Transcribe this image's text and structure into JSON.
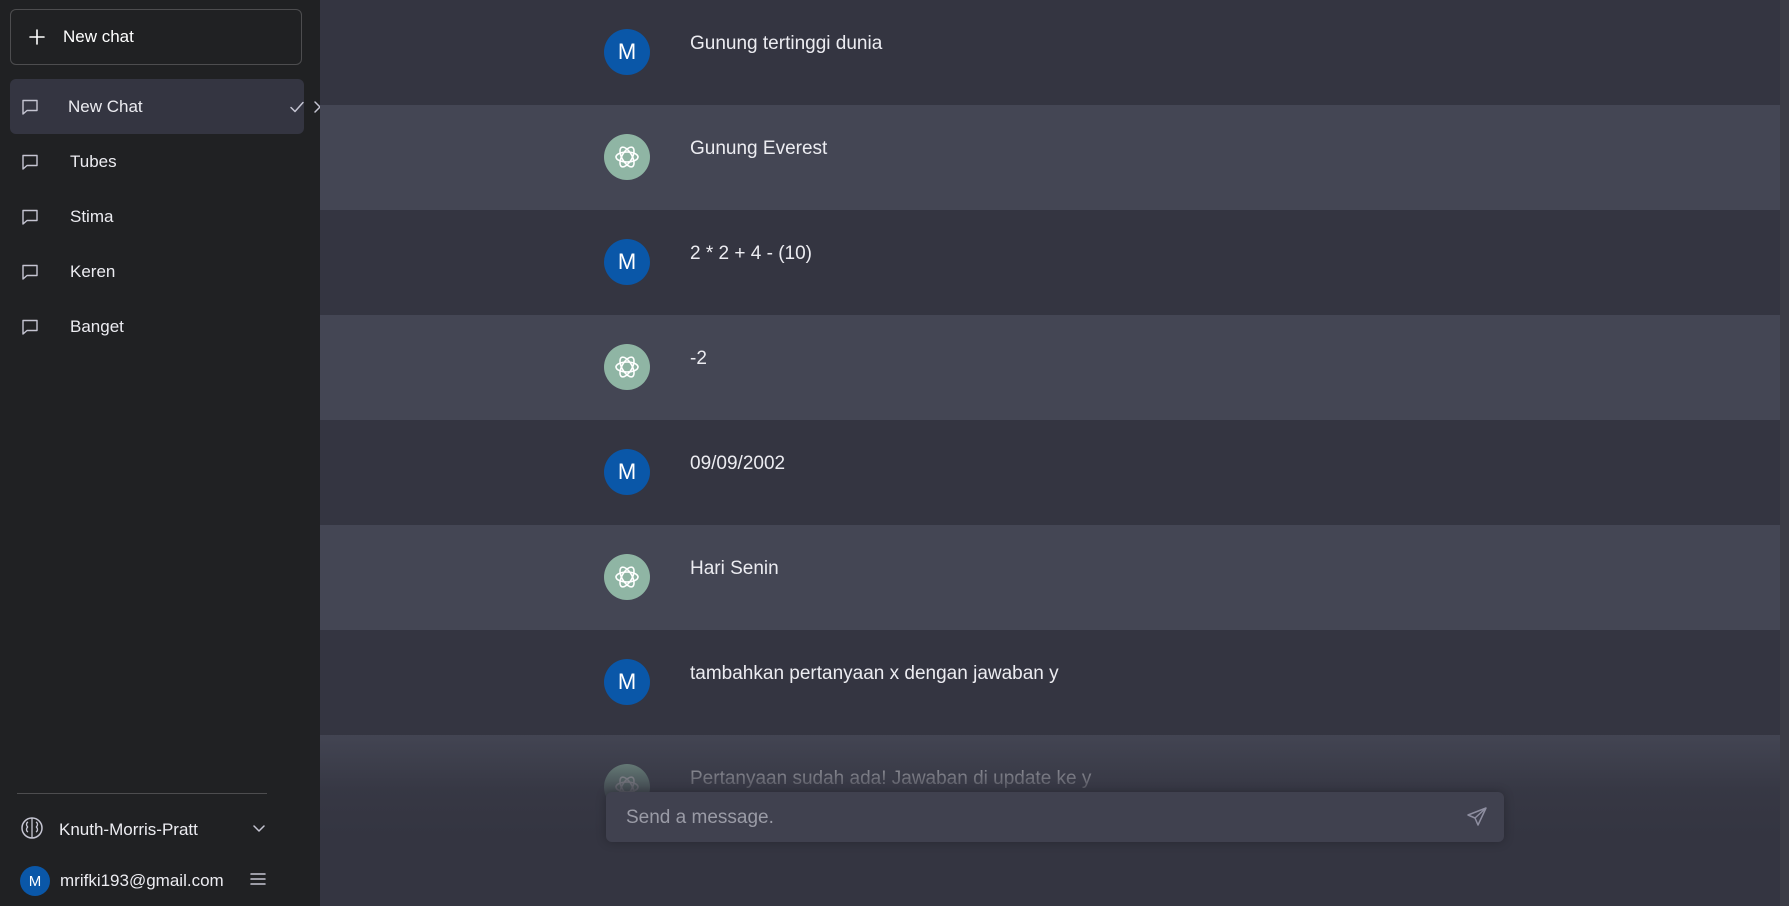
{
  "sidebar": {
    "new_chat_label": "New chat",
    "chats": [
      {
        "label": "New Chat",
        "editing": true
      },
      {
        "label": "Tubes"
      },
      {
        "label": "Stima"
      },
      {
        "label": "Keren"
      },
      {
        "label": "Banget"
      }
    ],
    "model": {
      "label": "Knuth-Morris-Pratt",
      "icon": "brain-icon"
    },
    "user": {
      "initial": "M",
      "email": "mrifki193@gmail.com"
    }
  },
  "messages": [
    {
      "role": "user",
      "avatar": "M",
      "text": "Gunung tertinggi dunia"
    },
    {
      "role": "bot",
      "avatar": "openai-logo-icon",
      "text": "Gunung Everest"
    },
    {
      "role": "user",
      "avatar": "M",
      "text": "2 * 2 + 4 - (10)"
    },
    {
      "role": "bot",
      "avatar": "openai-logo-icon",
      "text": "-2"
    },
    {
      "role": "user",
      "avatar": "M",
      "text": "09/09/2002"
    },
    {
      "role": "bot",
      "avatar": "openai-logo-icon",
      "text": "Hari Senin"
    },
    {
      "role": "user",
      "avatar": "M",
      "text": "tambahkan pertanyaan x dengan jawaban y"
    },
    {
      "role": "bot",
      "avatar": "openai-logo-icon",
      "text": "Pertanyaan sudah ada! Jawaban di update ke y"
    }
  ],
  "composer": {
    "placeholder": "Send a message."
  },
  "colors": {
    "sidebar_bg": "#202123",
    "user_row_bg": "#343541",
    "bot_row_bg": "#444654",
    "user_avatar": "#0a57a8",
    "bot_avatar": "#8fb5a4"
  }
}
